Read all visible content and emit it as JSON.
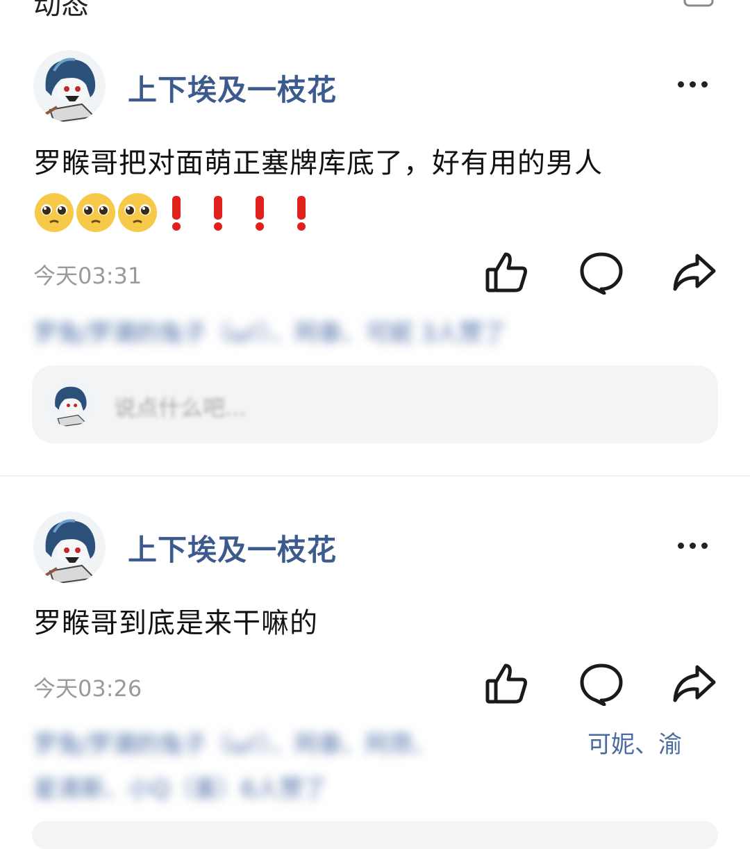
{
  "page": {
    "title": "动态"
  },
  "posts": [
    {
      "username": "上下埃及一枝花",
      "text": "罗睺哥把对面萌正塞牌库底了，好有用的男人",
      "time": "今天03:31",
      "likers_text": "罗兔/罗潮的兔子（ω!）、阿泰、可妮 3人赞了",
      "comment_placeholder": "说点什么吧..."
    },
    {
      "username": "上下埃及一枝花",
      "text": "罗睺哥到底是来干嘛的",
      "time": "今天03:26",
      "likers_text_line1": "罗兔/罗潮的兔子（ω!）、阿泰、阿昂、",
      "likers_visible": "可妮、渝",
      "likers_text_line2": "星清斯、小Q（喜）6人赞了"
    }
  ],
  "icons": {
    "topbar": "chat-icon",
    "more": "more-dots-icon",
    "like": "thumbs-up-icon",
    "comment": "comment-bubble-icon",
    "share": "share-arrow-icon",
    "emoji": "pleading-face-emoji",
    "exclaim": "red-exclamation-mark"
  },
  "colors": {
    "username": "#3d5a8c",
    "time": "#9a9a9a",
    "exclaim": "#e0201d"
  }
}
